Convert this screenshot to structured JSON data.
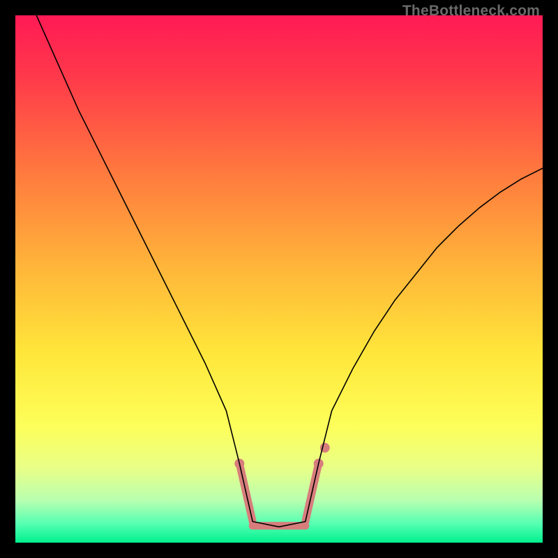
{
  "watermark": "TheBottleneck.com",
  "chart_data": {
    "type": "line",
    "title": "",
    "xlabel": "",
    "ylabel": "",
    "xlim": [
      0,
      100
    ],
    "ylim": [
      0,
      100
    ],
    "background_gradient_stops": [
      {
        "offset": 0,
        "color": "#ff1a55"
      },
      {
        "offset": 0.12,
        "color": "#ff3a4a"
      },
      {
        "offset": 0.3,
        "color": "#ff7a3e"
      },
      {
        "offset": 0.48,
        "color": "#ffb63a"
      },
      {
        "offset": 0.64,
        "color": "#ffe63a"
      },
      {
        "offset": 0.78,
        "color": "#fdff5a"
      },
      {
        "offset": 0.86,
        "color": "#e8ff88"
      },
      {
        "offset": 0.92,
        "color": "#b8ffb0"
      },
      {
        "offset": 0.965,
        "color": "#53ffb2"
      },
      {
        "offset": 1.0,
        "color": "#00f08d"
      }
    ],
    "series": [
      {
        "name": "curve",
        "color": "#000000",
        "stroke_width": 1.6,
        "x": [
          4,
          8,
          12,
          16,
          20,
          24,
          28,
          32,
          36,
          40,
          42.5,
          45,
          50,
          55,
          57.5,
          60,
          64,
          68,
          72,
          76,
          80,
          84,
          88,
          92,
          96,
          100
        ],
        "y": [
          100,
          91,
          82,
          74,
          66,
          58,
          50,
          42,
          34,
          25,
          15,
          4,
          3,
          4,
          15,
          25,
          33,
          40,
          46,
          51,
          56,
          60,
          63.5,
          66.5,
          69,
          71
        ]
      }
    ],
    "markers": {
      "color": "#d77d7c",
      "stroke_width": 11,
      "cap_radius": 7,
      "valley_x_range": [
        42.5,
        57.5
      ],
      "left_slope": {
        "x": [
          42.5,
          45
        ],
        "y": [
          15,
          4
        ]
      },
      "flat": {
        "x": [
          45,
          55
        ],
        "y": [
          3.2,
          3.2
        ]
      },
      "right_slope": {
        "x": [
          55,
          57.5
        ],
        "y": [
          4,
          15
        ]
      },
      "right_gap_marker": {
        "x": 58.7,
        "y": 18
      }
    }
  }
}
